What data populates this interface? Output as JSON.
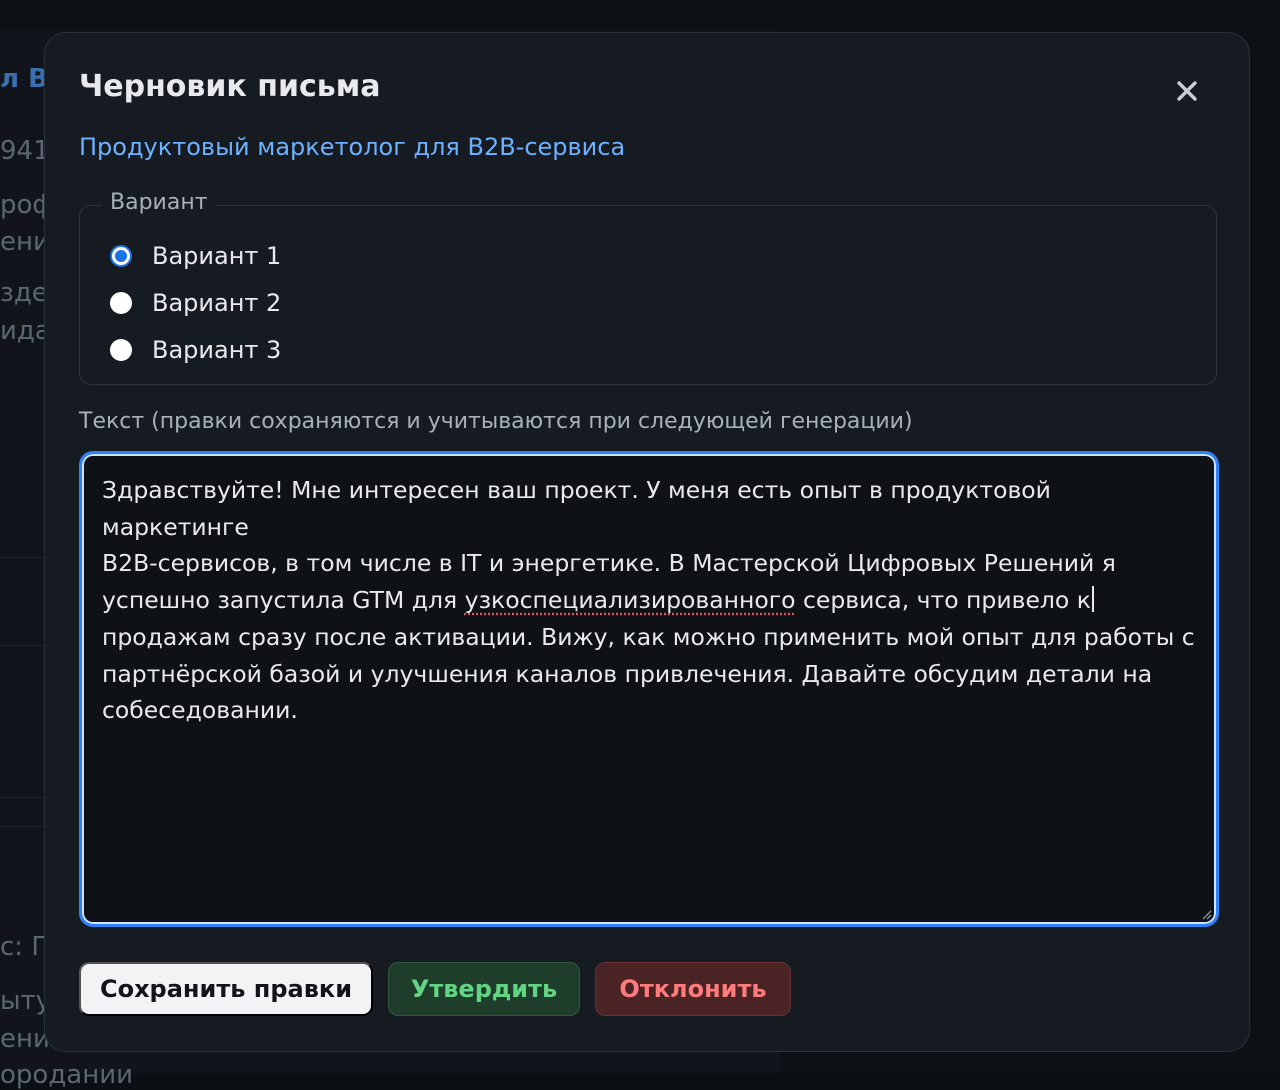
{
  "background": {
    "fragments": [
      "л B2",
      "941–",
      "роф",
      "ени",
      "здел",
      "идан",
      "с: Пр",
      "ыту",
      "ени",
      "ородании"
    ]
  },
  "modal": {
    "title": "Черновик письма",
    "subtitle": "Продуктовый маркетолог для B2B-сервиса",
    "close_icon": "close-icon",
    "variant_legend": "Вариант",
    "variants": [
      {
        "label": "Вариант 1",
        "checked": true
      },
      {
        "label": "Вариант 2",
        "checked": false
      },
      {
        "label": "Вариант 3",
        "checked": false
      }
    ],
    "text_label": "Текст (правки сохраняются и учитываются при следующей генерации)",
    "text_lines": [
      "Здравствуйте! Мне интересен ваш проект. У меня есть опыт в продуктовой маркетинге",
      "B2B-сервисов, в том числе в IT и энергетике. В Мастерской Цифровых Решений я",
      "успешно запустила GTM для ",
      "узкоспециализированного",
      " сервиса, что привело к",
      "продажам сразу после активации. Вижу, как можно применить мой опыт для работы с",
      "партнёрской базой и улучшения каналов привлечения. Давайте обсудим детали на",
      "собеседовании."
    ],
    "buttons": {
      "save": "Сохранить правки",
      "approve": "Утвердить",
      "reject": "Отклонить"
    }
  },
  "colors": {
    "accent": "#2f81f7",
    "link": "#6cb0ff",
    "approve": "#63d483",
    "reject": "#ff7b7b"
  }
}
